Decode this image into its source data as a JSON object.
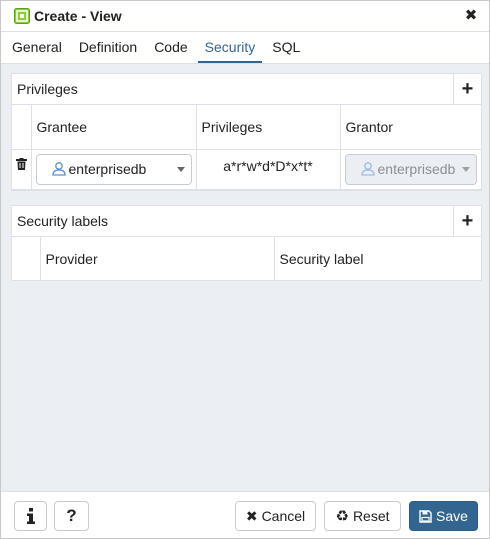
{
  "window": {
    "title": "Create - View"
  },
  "tabs": [
    {
      "label": "General"
    },
    {
      "label": "Definition"
    },
    {
      "label": "Code"
    },
    {
      "label": "Security"
    },
    {
      "label": "SQL"
    }
  ],
  "active_tab": "Security",
  "privileges": {
    "title": "Privileges",
    "columns": [
      "Grantee",
      "Privileges",
      "Grantor"
    ],
    "rows": [
      {
        "grantee": "enterprisedb",
        "privileges": "a*r*w*d*D*x*t*",
        "grantor": "enterprisedb"
      }
    ]
  },
  "security_labels": {
    "title": "Security labels",
    "columns": [
      "Provider",
      "Security label"
    ]
  },
  "footer": {
    "info_icon": "info-icon",
    "help_icon": "help-icon",
    "cancel_label": "Cancel",
    "reset_label": "Reset",
    "save_label": "Save"
  },
  "colors": {
    "accent": "#326690",
    "background": "#ebeef3",
    "border": "#dde0e6",
    "icon_green": "#8ccf3a"
  }
}
